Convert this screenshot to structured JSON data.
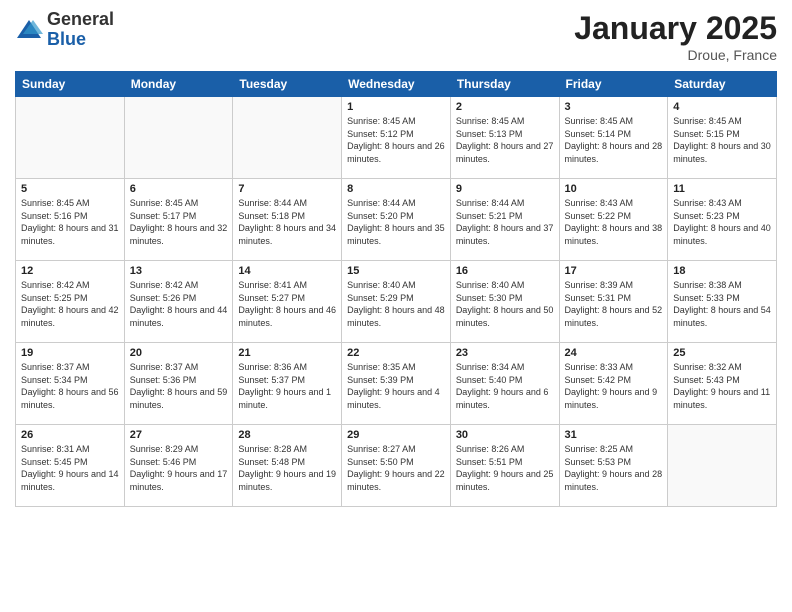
{
  "header": {
    "logo_general": "General",
    "logo_blue": "Blue",
    "month_title": "January 2025",
    "location": "Droue, France"
  },
  "days_of_week": [
    "Sunday",
    "Monday",
    "Tuesday",
    "Wednesday",
    "Thursday",
    "Friday",
    "Saturday"
  ],
  "weeks": [
    [
      {
        "day": "",
        "info": ""
      },
      {
        "day": "",
        "info": ""
      },
      {
        "day": "",
        "info": ""
      },
      {
        "day": "1",
        "info": "Sunrise: 8:45 AM\nSunset: 5:12 PM\nDaylight: 8 hours and 26 minutes."
      },
      {
        "day": "2",
        "info": "Sunrise: 8:45 AM\nSunset: 5:13 PM\nDaylight: 8 hours and 27 minutes."
      },
      {
        "day": "3",
        "info": "Sunrise: 8:45 AM\nSunset: 5:14 PM\nDaylight: 8 hours and 28 minutes."
      },
      {
        "day": "4",
        "info": "Sunrise: 8:45 AM\nSunset: 5:15 PM\nDaylight: 8 hours and 30 minutes."
      }
    ],
    [
      {
        "day": "5",
        "info": "Sunrise: 8:45 AM\nSunset: 5:16 PM\nDaylight: 8 hours and 31 minutes."
      },
      {
        "day": "6",
        "info": "Sunrise: 8:45 AM\nSunset: 5:17 PM\nDaylight: 8 hours and 32 minutes."
      },
      {
        "day": "7",
        "info": "Sunrise: 8:44 AM\nSunset: 5:18 PM\nDaylight: 8 hours and 34 minutes."
      },
      {
        "day": "8",
        "info": "Sunrise: 8:44 AM\nSunset: 5:20 PM\nDaylight: 8 hours and 35 minutes."
      },
      {
        "day": "9",
        "info": "Sunrise: 8:44 AM\nSunset: 5:21 PM\nDaylight: 8 hours and 37 minutes."
      },
      {
        "day": "10",
        "info": "Sunrise: 8:43 AM\nSunset: 5:22 PM\nDaylight: 8 hours and 38 minutes."
      },
      {
        "day": "11",
        "info": "Sunrise: 8:43 AM\nSunset: 5:23 PM\nDaylight: 8 hours and 40 minutes."
      }
    ],
    [
      {
        "day": "12",
        "info": "Sunrise: 8:42 AM\nSunset: 5:25 PM\nDaylight: 8 hours and 42 minutes."
      },
      {
        "day": "13",
        "info": "Sunrise: 8:42 AM\nSunset: 5:26 PM\nDaylight: 8 hours and 44 minutes."
      },
      {
        "day": "14",
        "info": "Sunrise: 8:41 AM\nSunset: 5:27 PM\nDaylight: 8 hours and 46 minutes."
      },
      {
        "day": "15",
        "info": "Sunrise: 8:40 AM\nSunset: 5:29 PM\nDaylight: 8 hours and 48 minutes."
      },
      {
        "day": "16",
        "info": "Sunrise: 8:40 AM\nSunset: 5:30 PM\nDaylight: 8 hours and 50 minutes."
      },
      {
        "day": "17",
        "info": "Sunrise: 8:39 AM\nSunset: 5:31 PM\nDaylight: 8 hours and 52 minutes."
      },
      {
        "day": "18",
        "info": "Sunrise: 8:38 AM\nSunset: 5:33 PM\nDaylight: 8 hours and 54 minutes."
      }
    ],
    [
      {
        "day": "19",
        "info": "Sunrise: 8:37 AM\nSunset: 5:34 PM\nDaylight: 8 hours and 56 minutes."
      },
      {
        "day": "20",
        "info": "Sunrise: 8:37 AM\nSunset: 5:36 PM\nDaylight: 8 hours and 59 minutes."
      },
      {
        "day": "21",
        "info": "Sunrise: 8:36 AM\nSunset: 5:37 PM\nDaylight: 9 hours and 1 minute."
      },
      {
        "day": "22",
        "info": "Sunrise: 8:35 AM\nSunset: 5:39 PM\nDaylight: 9 hours and 4 minutes."
      },
      {
        "day": "23",
        "info": "Sunrise: 8:34 AM\nSunset: 5:40 PM\nDaylight: 9 hours and 6 minutes."
      },
      {
        "day": "24",
        "info": "Sunrise: 8:33 AM\nSunset: 5:42 PM\nDaylight: 9 hours and 9 minutes."
      },
      {
        "day": "25",
        "info": "Sunrise: 8:32 AM\nSunset: 5:43 PM\nDaylight: 9 hours and 11 minutes."
      }
    ],
    [
      {
        "day": "26",
        "info": "Sunrise: 8:31 AM\nSunset: 5:45 PM\nDaylight: 9 hours and 14 minutes."
      },
      {
        "day": "27",
        "info": "Sunrise: 8:29 AM\nSunset: 5:46 PM\nDaylight: 9 hours and 17 minutes."
      },
      {
        "day": "28",
        "info": "Sunrise: 8:28 AM\nSunset: 5:48 PM\nDaylight: 9 hours and 19 minutes."
      },
      {
        "day": "29",
        "info": "Sunrise: 8:27 AM\nSunset: 5:50 PM\nDaylight: 9 hours and 22 minutes."
      },
      {
        "day": "30",
        "info": "Sunrise: 8:26 AM\nSunset: 5:51 PM\nDaylight: 9 hours and 25 minutes."
      },
      {
        "day": "31",
        "info": "Sunrise: 8:25 AM\nSunset: 5:53 PM\nDaylight: 9 hours and 28 minutes."
      },
      {
        "day": "",
        "info": ""
      }
    ]
  ]
}
